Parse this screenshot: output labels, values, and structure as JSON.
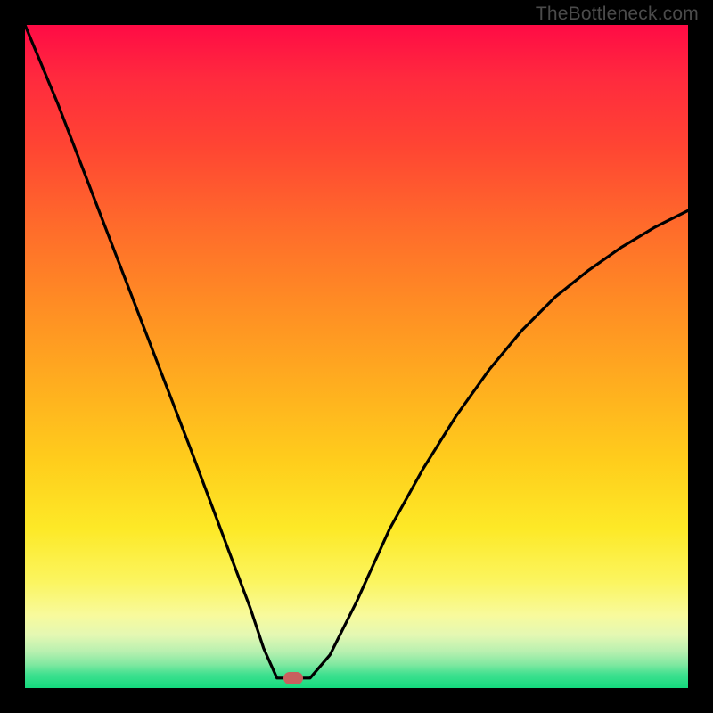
{
  "watermark": "TheBottleneck.com",
  "marker": {
    "x_frac": 0.405,
    "y_frac": 0.985
  },
  "chart_data": {
    "type": "line",
    "title": "",
    "xlabel": "",
    "ylabel": "",
    "xlim": [
      0,
      1
    ],
    "ylim": [
      0,
      1
    ],
    "series": [
      {
        "name": "bottleneck-curve",
        "x": [
          0.0,
          0.05,
          0.1,
          0.15,
          0.2,
          0.25,
          0.28,
          0.31,
          0.34,
          0.36,
          0.38,
          0.4,
          0.43,
          0.46,
          0.5,
          0.55,
          0.6,
          0.65,
          0.7,
          0.75,
          0.8,
          0.85,
          0.9,
          0.95,
          1.0
        ],
        "y": [
          1.0,
          0.88,
          0.75,
          0.62,
          0.49,
          0.36,
          0.28,
          0.2,
          0.12,
          0.06,
          0.015,
          0.015,
          0.015,
          0.05,
          0.13,
          0.24,
          0.33,
          0.41,
          0.48,
          0.54,
          0.59,
          0.63,
          0.665,
          0.695,
          0.72
        ]
      }
    ],
    "annotations": [
      {
        "type": "marker",
        "x": 0.405,
        "y": 0.015,
        "color": "#c9605e"
      }
    ]
  }
}
